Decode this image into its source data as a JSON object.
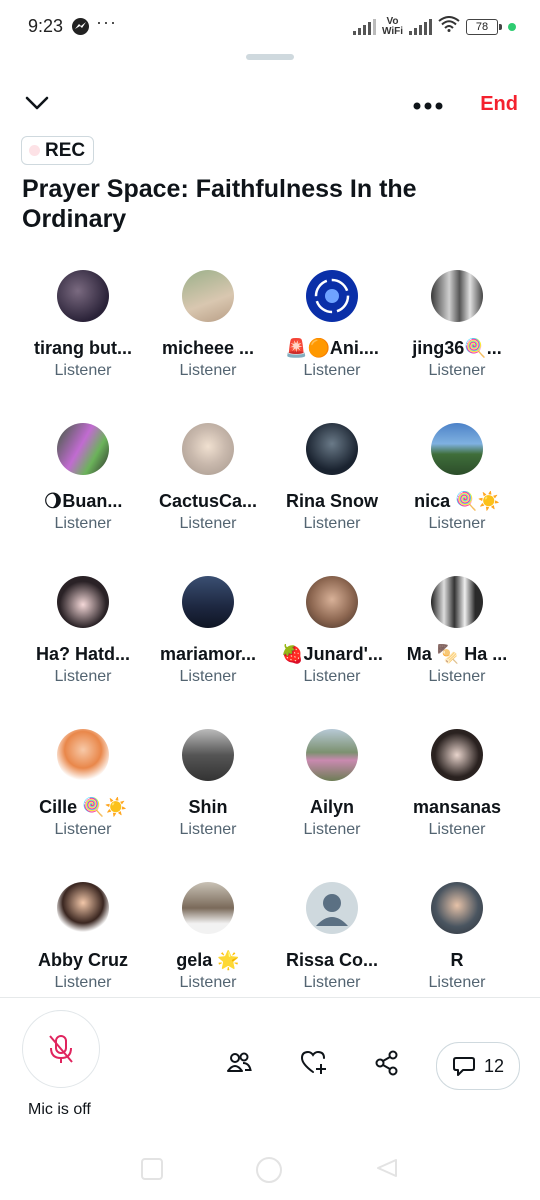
{
  "status_bar": {
    "time": "9:23",
    "more": "···",
    "vo": "Vo",
    "wifi": "WiFi",
    "battery": "78"
  },
  "header": {
    "end_label": "End"
  },
  "rec_label": "REC",
  "title": "Prayer Space: Faithfulness In the Ordinary",
  "participants": [
    {
      "name": "tirang but...",
      "role": "Listener"
    },
    {
      "name": "micheee ...",
      "role": "Listener"
    },
    {
      "name": "🚨🟠Ani....",
      "role": "Listener"
    },
    {
      "name": "jing36🍭...",
      "role": "Listener"
    },
    {
      "name": "🌖Buan...",
      "role": "Listener"
    },
    {
      "name": "CactusCa...",
      "role": "Listener"
    },
    {
      "name": "Rina Snow",
      "role": "Listener"
    },
    {
      "name": "nica 🍭☀️",
      "role": "Listener"
    },
    {
      "name": "Ha? Hatd...",
      "role": "Listener"
    },
    {
      "name": "mariamor...",
      "role": "Listener"
    },
    {
      "name": "🍓Junard'...",
      "role": "Listener"
    },
    {
      "name": "Ma 🍢 Ha ...",
      "role": "Listener"
    },
    {
      "name": "Cille 🍭☀️",
      "role": "Listener"
    },
    {
      "name": "Shin",
      "role": "Listener"
    },
    {
      "name": "Ailyn",
      "role": "Listener"
    },
    {
      "name": "mansanas",
      "role": "Listener"
    },
    {
      "name": "Abby Cruz",
      "role": "Listener"
    },
    {
      "name": "gela 🌟",
      "role": "Listener"
    },
    {
      "name": "Rissa Co...",
      "role": "Listener"
    },
    {
      "name": "R",
      "role": "Listener"
    }
  ],
  "bottom": {
    "mic_label": "Mic is off",
    "comment_count": "12"
  },
  "colors": {
    "accent_red": "#f4212e",
    "secondary_text": "#536471",
    "mic_off_icon": "#e0245e"
  }
}
